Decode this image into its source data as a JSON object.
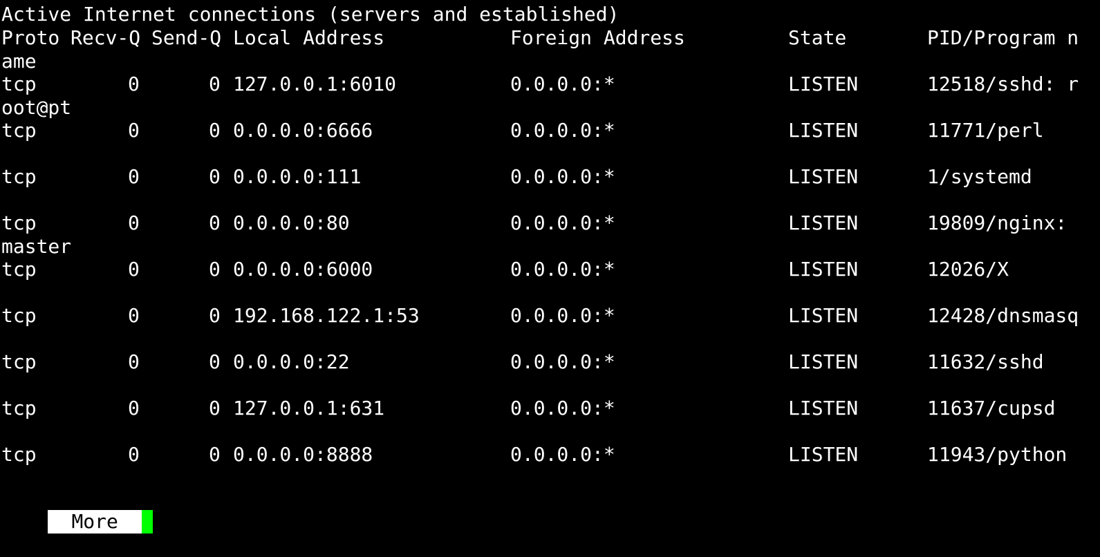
{
  "terminal": {
    "heading": "Active Internet connections (servers and established)",
    "header": {
      "proto": "Proto",
      "recvq": "Recv-Q",
      "sendq": "Send-Q",
      "local": "Local Address",
      "foreign": "Foreign Address",
      "state": "State",
      "program": "PID/Program n",
      "program_wrap": "ame"
    },
    "rows": [
      {
        "proto": "tcp",
        "recvq": "0",
        "sendq": "0",
        "local": "127.0.0.1:6010",
        "foreign": "0.0.0.0:*",
        "state": "LISTEN",
        "program": "12518/sshd: r",
        "program_wrap": "oot@pt"
      },
      {
        "proto": "tcp",
        "recvq": "0",
        "sendq": "0",
        "local": "0.0.0.0:6666",
        "foreign": "0.0.0.0:*",
        "state": "LISTEN",
        "program": "11771/perl",
        "program_wrap": ""
      },
      {
        "proto": "tcp",
        "recvq": "0",
        "sendq": "0",
        "local": "0.0.0.0:111",
        "foreign": "0.0.0.0:*",
        "state": "LISTEN",
        "program": "1/systemd",
        "program_wrap": ""
      },
      {
        "proto": "tcp",
        "recvq": "0",
        "sendq": "0",
        "local": "0.0.0.0:80",
        "foreign": "0.0.0.0:*",
        "state": "LISTEN",
        "program": "19809/nginx:",
        "program_wrap": "master"
      },
      {
        "proto": "tcp",
        "recvq": "0",
        "sendq": "0",
        "local": "0.0.0.0:6000",
        "foreign": "0.0.0.0:*",
        "state": "LISTEN",
        "program": "12026/X",
        "program_wrap": ""
      },
      {
        "proto": "tcp",
        "recvq": "0",
        "sendq": "0",
        "local": "192.168.122.1:53",
        "foreign": "0.0.0.0:*",
        "state": "LISTEN",
        "program": "12428/dnsmasq",
        "program_wrap": ""
      },
      {
        "proto": "tcp",
        "recvq": "0",
        "sendq": "0",
        "local": "0.0.0.0:22",
        "foreign": "0.0.0.0:*",
        "state": "LISTEN",
        "program": "11632/sshd",
        "program_wrap": ""
      },
      {
        "proto": "tcp",
        "recvq": "0",
        "sendq": "0",
        "local": "127.0.0.1:631",
        "foreign": "0.0.0.0:*",
        "state": "LISTEN",
        "program": "11637/cupsd",
        "program_wrap": ""
      },
      {
        "proto": "tcp",
        "recvq": "0",
        "sendq": "0",
        "local": "0.0.0.0:8888",
        "foreign": "0.0.0.0:*",
        "state": "LISTEN",
        "program": "11943/python",
        "program_wrap": ""
      }
    ],
    "pager": {
      "label": "More",
      "cursor_color": "#00ff00"
    },
    "colors": {
      "background": "#000000",
      "foreground": "#ffffff"
    }
  }
}
